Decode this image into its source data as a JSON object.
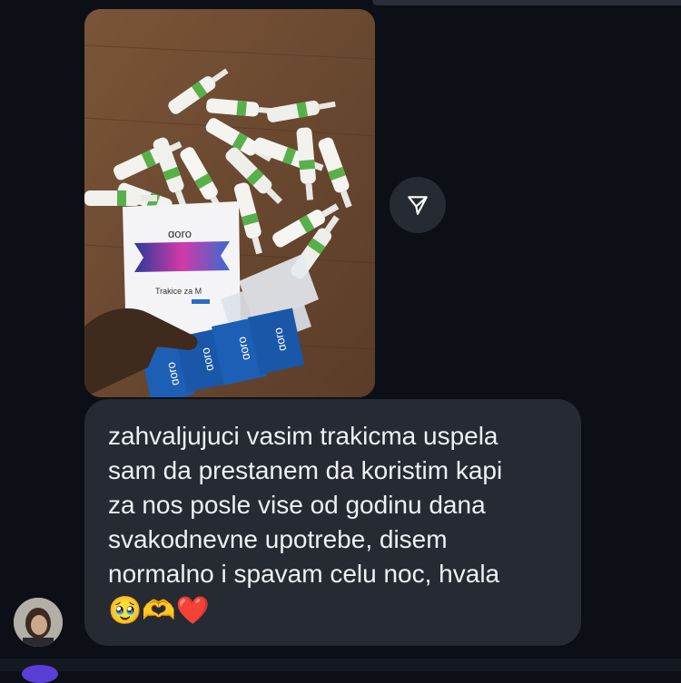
{
  "message": {
    "lines": [
      "zahvaljujuci vasim trakicma uspela",
      "sam da prestanem da koristim kapi",
      "za nos posle vise od godinu dana",
      "svakodnevne upotrebe, disem",
      "normalno i spavam celu noc, hvala"
    ],
    "emojis": "🥹🫶❤️"
  },
  "photo": {
    "brand": "ɑoro",
    "package_text": "Trakice za M",
    "strip_brand": "ɑoro"
  },
  "icons": {
    "share": "paper-plane-icon",
    "avatar": "user-avatar"
  },
  "colors": {
    "background": "#0c0f16",
    "bubble": "#262a33",
    "text": "#eef0f4",
    "package_blue": "#1d5fb5"
  }
}
